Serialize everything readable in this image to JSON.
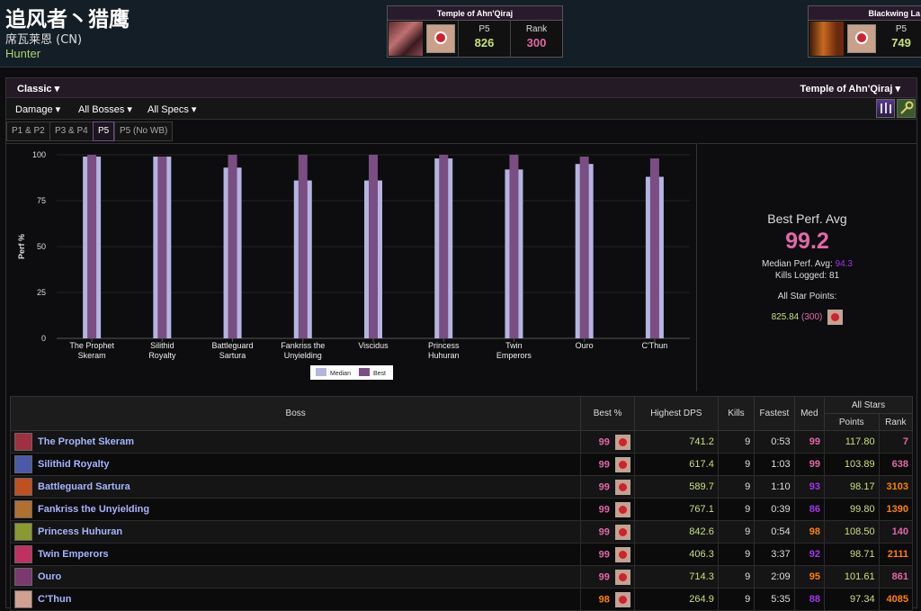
{
  "character": {
    "name": "追风者丶猎鹰",
    "server": "席瓦莱恩 (CN)",
    "class": "Hunter"
  },
  "zone_cards": [
    {
      "title": "Temple of Ahn'Qiraj",
      "phase_label": "P5",
      "score": "826",
      "rank_label": "Rank",
      "rank": "300"
    },
    {
      "title": "Blackwing La",
      "phase_label": "P5",
      "score": "749"
    }
  ],
  "filters": {
    "mode": "Classic",
    "zone": "Temple of Ahn'Qiraj",
    "metric": "Damage",
    "bosses": "All Bosses",
    "specs": "All Specs"
  },
  "partition_tabs": [
    "P1 & P2",
    "P3 & P4",
    "P5",
    "P5 (No WB)"
  ],
  "active_tab": "P5",
  "summary": {
    "best_label": "Best Perf. Avg",
    "best_value": "99.2",
    "median_label": "Median Perf. Avg:",
    "median_value": "94.3",
    "kills_label": "Kills Logged:",
    "kills_value": "81",
    "points_label": "All Star Points:",
    "points_value": "825.84",
    "points_rank": "(300)"
  },
  "chart_data": {
    "type": "bar",
    "ylabel": "Perf %",
    "ylim": [
      0,
      100
    ],
    "yticks": [
      0,
      25,
      50,
      75,
      100
    ],
    "categories": [
      "The Prophet Skeram",
      "Silithid Royalty",
      "Battleguard Sartura",
      "Fankriss the Unyielding",
      "Viscidus",
      "Princess Huhuran",
      "Twin Emperors",
      "Ouro",
      "C'Thun"
    ],
    "category_lines": [
      [
        "The Prophet",
        "Skeram"
      ],
      [
        "Silithid",
        "Royalty"
      ],
      [
        "Battleguard",
        "Sartura"
      ],
      [
        "Fankriss the",
        "Unyielding"
      ],
      [
        "Viscidus"
      ],
      [
        "Princess",
        "Huhuran"
      ],
      [
        "Twin",
        "Emperors"
      ],
      [
        "Ouro"
      ],
      [
        "C'Thun"
      ]
    ],
    "series": [
      {
        "name": "Median",
        "color": "#b4b4e0",
        "values": [
          99,
          99,
          93,
          86,
          86,
          98,
          92,
          95,
          88
        ]
      },
      {
        "name": "Best",
        "color": "#7a4d83",
        "values": [
          100,
          99,
          100,
          100,
          100,
          100,
          100,
          99,
          98
        ]
      }
    ]
  },
  "table": {
    "headers": {
      "boss": "Boss",
      "best": "Best %",
      "dps": "Highest DPS",
      "kills": "Kills",
      "fastest": "Fastest",
      "med": "Med",
      "allstars": "All Stars",
      "points": "Points",
      "rank": "Rank"
    },
    "rows": [
      {
        "boss": "The Prophet Skeram",
        "best": "99",
        "dps": "741.2",
        "kills": "9",
        "fastest": "0:53",
        "med": "99",
        "points": "117.80",
        "rank": "7",
        "best_color": "#e268a8",
        "med_color": "#e268a8",
        "rank_color": "#e268a8",
        "icon_color": "#a03040"
      },
      {
        "boss": "Silithid Royalty",
        "best": "99",
        "dps": "617.4",
        "kills": "9",
        "fastest": "1:03",
        "med": "99",
        "points": "103.89",
        "rank": "638",
        "best_color": "#e268a8",
        "med_color": "#e268a8",
        "rank_color": "#e268a8",
        "icon_color": "#4a5aa8"
      },
      {
        "boss": "Battleguard Sartura",
        "best": "99",
        "dps": "589.7",
        "kills": "9",
        "fastest": "1:10",
        "med": "93",
        "points": "98.17",
        "rank": "3103",
        "best_color": "#e268a8",
        "med_color": "#a335ee",
        "rank_color": "#ff8000",
        "icon_color": "#c05020"
      },
      {
        "boss": "Fankriss the Unyielding",
        "best": "99",
        "dps": "767.1",
        "kills": "9",
        "fastest": "0:39",
        "med": "86",
        "points": "99.80",
        "rank": "1390",
        "best_color": "#e268a8",
        "med_color": "#a335ee",
        "rank_color": "#ff8000",
        "icon_color": "#b07030"
      },
      {
        "boss": "Princess Huhuran",
        "best": "99",
        "dps": "842.6",
        "kills": "9",
        "fastest": "0:54",
        "med": "98",
        "points": "108.50",
        "rank": "140",
        "best_color": "#e268a8",
        "med_color": "#ff8000",
        "rank_color": "#e268a8",
        "icon_color": "#8a9a30"
      },
      {
        "boss": "Twin Emperors",
        "best": "99",
        "dps": "406.3",
        "kills": "9",
        "fastest": "3:37",
        "med": "92",
        "points": "98.71",
        "rank": "2111",
        "best_color": "#e268a8",
        "med_color": "#a335ee",
        "rank_color": "#ff8000",
        "icon_color": "#c03060"
      },
      {
        "boss": "Ouro",
        "best": "99",
        "dps": "714.3",
        "kills": "9",
        "fastest": "2:09",
        "med": "95",
        "points": "101.61",
        "rank": "861",
        "best_color": "#e268a8",
        "med_color": "#ff8000",
        "rank_color": "#e268a8",
        "icon_color": "#7a3a70"
      },
      {
        "boss": "C'Thun",
        "best": "98",
        "dps": "264.9",
        "kills": "9",
        "fastest": "5:35",
        "med": "88",
        "points": "97.34",
        "rank": "4085",
        "best_color": "#ff8000",
        "med_color": "#a335ee",
        "rank_color": "#ff8000",
        "icon_color": "#d0a090"
      }
    ]
  },
  "colors": {
    "dps": "#c8e07a",
    "accent_pink": "#e268a8",
    "median_purple": "#a335ee"
  }
}
